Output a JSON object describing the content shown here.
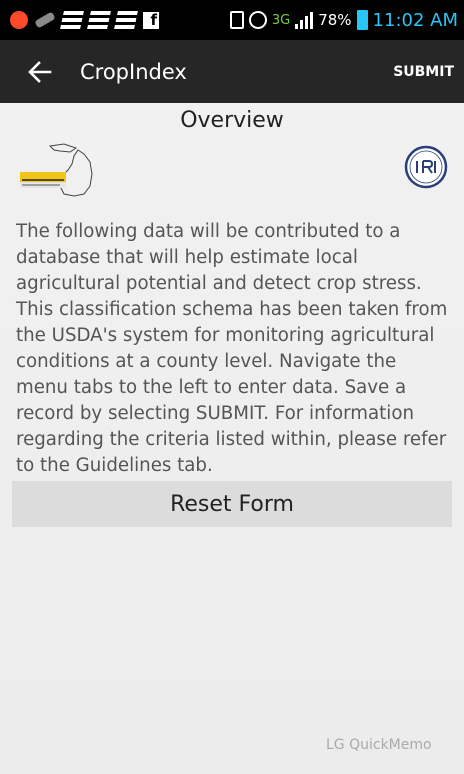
{
  "status_bar": {
    "network": "3G",
    "battery": "78%",
    "time": "11:02 AM",
    "colors": {
      "accent": "#27c6f5",
      "network": "#7ad04b"
    }
  },
  "action_bar": {
    "title": "CropIndex",
    "submit_label": "SUBMIT"
  },
  "content": {
    "heading": "Overview",
    "logos": {
      "left_logo": "Michigan Tech Research Institute",
      "right_logo": "IRI"
    },
    "description": "The following data will be contributed to a database that will help estimate local agricultural potential and detect crop stress. This classification schema has been taken from the USDA's system for monitoring agricultural conditions at a county level. Navigate the menu tabs to the left to enter data. Save a record by selecting SUBMIT. For information regarding the criteria listed within, please refer to the Guidelines tab.",
    "reset_label": "Reset Form"
  },
  "overlay": {
    "quickmemo": "LG QuickMemo"
  }
}
